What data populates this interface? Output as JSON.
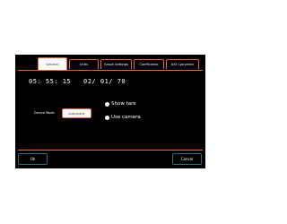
{
  "tabs": [
    {
      "label": "General",
      "active": true
    },
    {
      "label": "Units",
      "active": false
    },
    {
      "label": "Graph Settings",
      "active": false
    },
    {
      "label": "Coefficients",
      "active": false
    },
    {
      "label": "A/D Converter",
      "active": false
    }
  ],
  "clock": {
    "time": "05: 55: 15",
    "date": "02/ 01/ 70"
  },
  "device_mode": {
    "label": "Device Mode",
    "value": "Automatic"
  },
  "options": {
    "show_tare": "Show tare",
    "use_camera": "Use camera"
  },
  "buttons": {
    "ok": "Ok",
    "cancel": "Cancel"
  },
  "colors": {
    "accent": "#e0683f",
    "button_border": "#2a6e78",
    "background": "#000000"
  }
}
